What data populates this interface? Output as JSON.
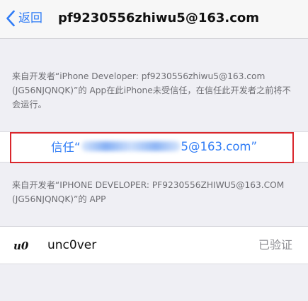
{
  "nav": {
    "back_label": "返回",
    "title": "pf9230556zhiwu5@163.com"
  },
  "section1": {
    "description": "来自开发者“iPhone Developer: pf9230556zhiwu5@163.com (JG56NJQNQK)”的 App在此iPhone未受信任，在信任此开发者之前将不会运行。"
  },
  "trust": {
    "prefix": "信任“",
    "suffix": "5@163.com”"
  },
  "section2": {
    "description": "来自开发者“IPHONE DEVELOPER: PF9230556ZHIWU5@163.COM (JG56NJQNQK)”的 APP"
  },
  "app": {
    "icon_text": "u0",
    "name": "unc0ver",
    "status": "已验证"
  },
  "colors": {
    "accent": "#2f7cf6",
    "highlight": "#d9262c",
    "background": "#efeff4"
  }
}
